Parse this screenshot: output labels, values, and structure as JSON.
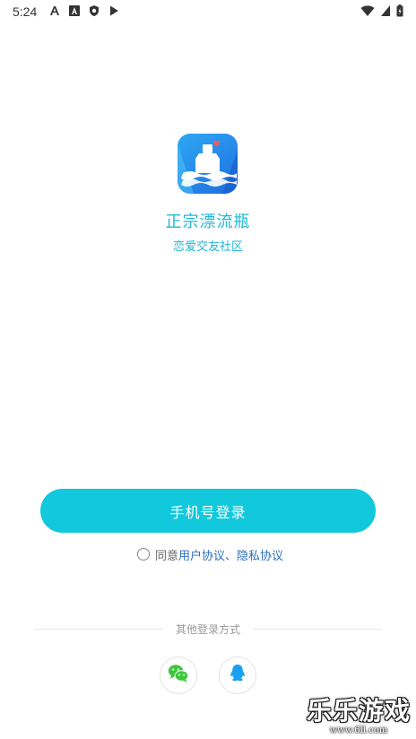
{
  "status_bar": {
    "time": "5:24",
    "left_icons": [
      "font-icon",
      "a-square-icon",
      "shield-icon",
      "play-store-icon"
    ],
    "right_icons": [
      "wifi-icon",
      "signal-icon",
      "battery-icon"
    ]
  },
  "app": {
    "name": "正宗漂流瓶",
    "slogan": "恋爱交友社区",
    "logo_icon": "bottle-logo-icon"
  },
  "login": {
    "phone_login_label": "手机号登录"
  },
  "agreement": {
    "prefix": "同意",
    "user_agreement": "用户协议",
    "separator": "、",
    "privacy_agreement": "隐私协议"
  },
  "other_login": {
    "label": "其他登录方式",
    "methods": [
      {
        "name": "wechat-icon"
      },
      {
        "name": "qq-icon"
      }
    ]
  },
  "watermark": {
    "main": "乐乐游戏",
    "sub": "www.6ll.com"
  },
  "colors": {
    "accent": "#12c8dc",
    "brand_text": "#1fb8d6",
    "link": "#2e6fb8",
    "wechat": "#3ec63e",
    "qq": "#1aa0f0"
  }
}
